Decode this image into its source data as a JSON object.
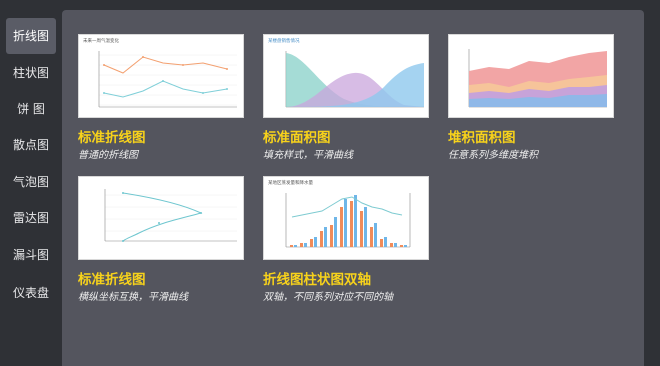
{
  "sidebar": {
    "items": [
      {
        "label": "折线图",
        "active": true
      },
      {
        "label": "柱状图",
        "active": false
      },
      {
        "label": "饼  图",
        "active": false
      },
      {
        "label": "散点图",
        "active": false
      },
      {
        "label": "气泡图",
        "active": false
      },
      {
        "label": "雷达图",
        "active": false
      },
      {
        "label": "漏斗图",
        "active": false
      },
      {
        "label": "仪表盘",
        "active": false
      }
    ]
  },
  "cards": [
    {
      "title": "标准折线图",
      "desc": "普通的折线图",
      "thumb_caption": "未来一周气温变化"
    },
    {
      "title": "标准面积图",
      "desc": "填充样式，平滑曲线",
      "thumb_caption": "某楼盘销售情况"
    },
    {
      "title": "堆积面积图",
      "desc": "任意系列多维度堆积",
      "thumb_caption": ""
    },
    {
      "title": "标准折线图",
      "desc": "横纵坐标互换，平滑曲线",
      "thumb_caption": ""
    },
    {
      "title": "折线图柱状图双轴",
      "desc": "双轴，不同系列对应不同的轴",
      "thumb_caption": "某地区蒸发量和降水量"
    }
  ],
  "colors": {
    "accent_title": "#f7d21b",
    "panel": "#54555e",
    "background": "#2f3136",
    "active_item": "#5a5c66"
  }
}
